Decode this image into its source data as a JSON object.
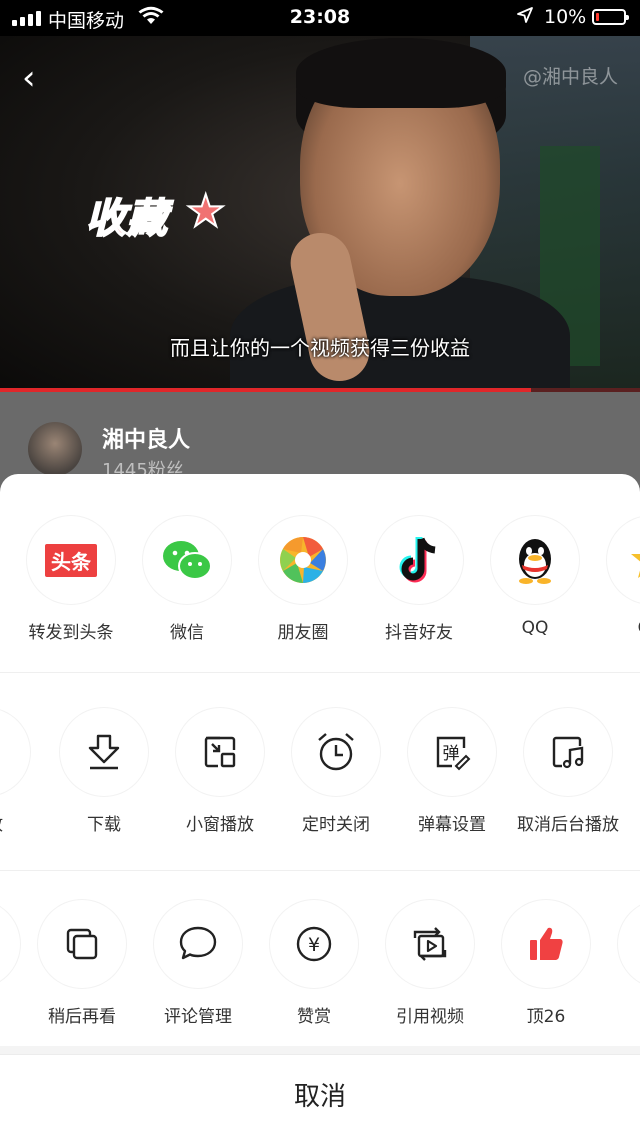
{
  "status_bar": {
    "carrier": "中国移动",
    "time": "23:08",
    "battery": "10%",
    "battery_level": 0.1
  },
  "video": {
    "watermark": "@湘中良人",
    "sticker_text": "收藏",
    "subtitle": "而且让你的一个视频获得三份收益",
    "progress": 0.83
  },
  "author": {
    "name": "湘中良人",
    "fans": "1445粉丝"
  },
  "share_row": [
    {
      "label": "转发到头条",
      "icon": "toutiao-icon"
    },
    {
      "label": "微信",
      "icon": "wechat-icon"
    },
    {
      "label": "朋友圈",
      "icon": "moments-icon"
    },
    {
      "label": "抖音好友",
      "icon": "douyin-icon"
    },
    {
      "label": "QQ",
      "icon": "qq-icon"
    },
    {
      "label": "QQ",
      "icon": "qzone-icon"
    }
  ],
  "tools_row": [
    {
      "label": "播放",
      "icon": "play-icon"
    },
    {
      "label": "下载",
      "icon": "download-icon"
    },
    {
      "label": "小窗播放",
      "icon": "mini-window-icon"
    },
    {
      "label": "定时关闭",
      "icon": "alarm-clock-icon"
    },
    {
      "label": "弹幕设置",
      "icon": "danmaku-icon"
    },
    {
      "label": "取消后台播放",
      "icon": "background-music-icon"
    }
  ],
  "more_row": [
    {
      "label": "",
      "icon": "partial-icon"
    },
    {
      "label": "稍后再看",
      "icon": "watch-later-icon"
    },
    {
      "label": "评论管理",
      "icon": "comment-icon"
    },
    {
      "label": "赞赏",
      "icon": "yuan-icon"
    },
    {
      "label": "引用视频",
      "icon": "quote-video-icon"
    },
    {
      "label": "顶26",
      "icon": "thumbs-up-icon"
    }
  ],
  "toutiao_badge": "头条",
  "danmaku_glyph": "弹",
  "yuan_glyph": "¥",
  "cancel_label": "取消",
  "colors": {
    "accent_red": "#e0272a",
    "toutiao_red": "#ed4040",
    "wechat_green": "#3bc846"
  }
}
